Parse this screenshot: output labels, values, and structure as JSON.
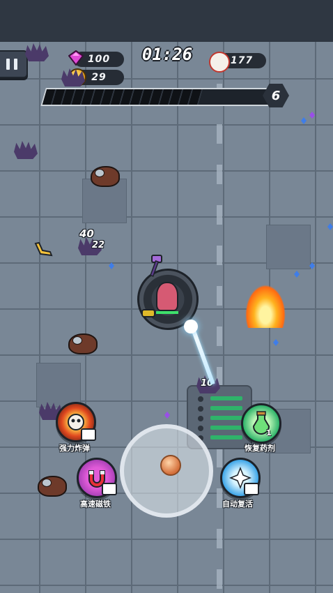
{
  "hud": {
    "timer": "01:26",
    "gems": "100",
    "coins": "29",
    "kills": "177",
    "level": "6",
    "xp_progress": 0.68
  },
  "icons": {
    "pause": "pause-icon",
    "gem": "pink-gem-icon",
    "coin": "gold-coin-icon",
    "kills": "skull-target-icon"
  },
  "damage_numbers": [
    "40",
    "22",
    "10"
  ],
  "skills": [
    {
      "label": "强力炸弹",
      "icon": "bomb-icon"
    },
    {
      "label": "高速磁铁",
      "icon": "magnet-icon"
    },
    {
      "label": "恢复药剂",
      "icon": "potion-icon",
      "count": "1"
    },
    {
      "label": "自动复活",
      "icon": "revive-icon"
    }
  ],
  "colors": {
    "floor": "#798796",
    "hud_bar": "#2f3742",
    "xp_fill": "#0f1216",
    "player_hp": "#3ee06b"
  }
}
